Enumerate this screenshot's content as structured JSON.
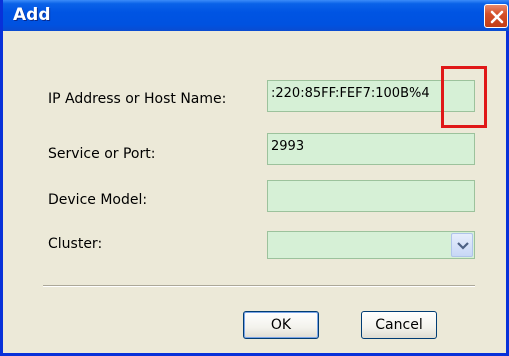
{
  "window": {
    "title": "Add",
    "close_icon": "close-icon"
  },
  "form": {
    "ip_label": "IP Address or Host Name:",
    "ip_value": ":220:85FF:FEF7:100B%4",
    "service_label": "Service or Port:",
    "service_value": "2993",
    "model_label": "Device Model:",
    "model_value": "",
    "cluster_label": "Cluster:",
    "cluster_value": ""
  },
  "buttons": {
    "ok": "OK",
    "cancel": "Cancel"
  },
  "colors": {
    "title_bar": "#0054e3",
    "field_bg": "#d6f0d6",
    "highlight": "#e01818"
  }
}
